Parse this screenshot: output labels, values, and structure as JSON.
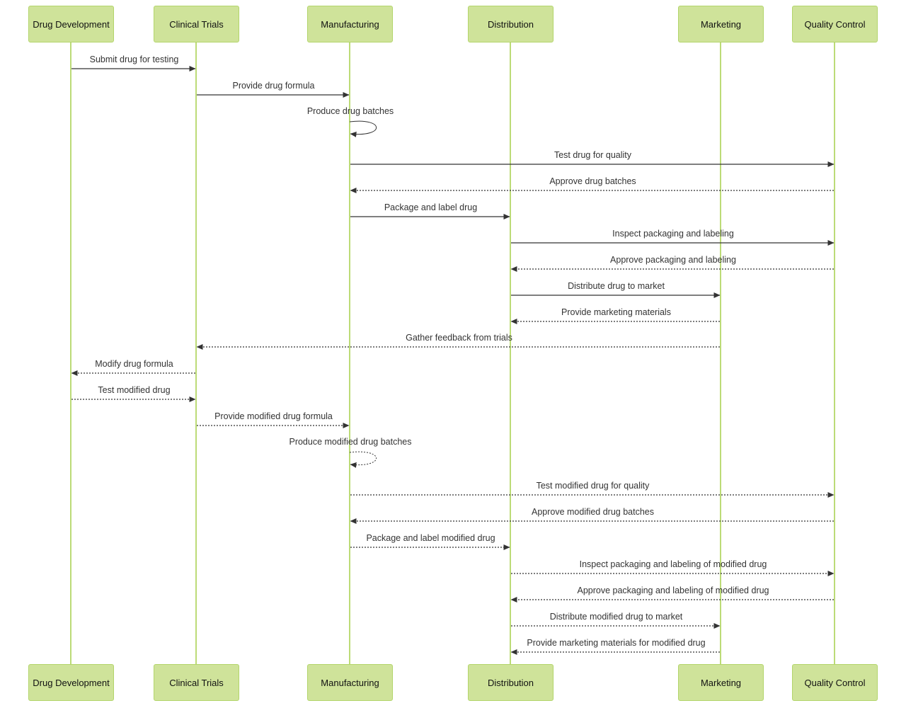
{
  "participants": [
    "Drug Development",
    "Clinical Trials",
    "Manufacturing",
    "Distribution",
    "Marketing",
    "Quality Control"
  ],
  "colors": {
    "actor_fill": "#cfe39a",
    "actor_border": "#b3d56b",
    "lifeline": "#a6cf4a",
    "arrow": "#333333"
  },
  "messages": [
    {
      "from": 0,
      "to": 1,
      "label": "Submit drug for testing",
      "style": "solid"
    },
    {
      "from": 1,
      "to": 2,
      "label": "Provide drug formula",
      "style": "solid"
    },
    {
      "from": 2,
      "to": 2,
      "label": "Produce drug batches",
      "style": "solid"
    },
    {
      "from": 2,
      "to": 5,
      "label": "Test drug for quality",
      "style": "solid"
    },
    {
      "from": 5,
      "to": 2,
      "label": "Approve drug batches",
      "style": "dotted"
    },
    {
      "from": 2,
      "to": 3,
      "label": "Package and label drug",
      "style": "solid"
    },
    {
      "from": 3,
      "to": 5,
      "label": "Inspect packaging and labeling",
      "style": "solid"
    },
    {
      "from": 5,
      "to": 3,
      "label": "Approve packaging and labeling",
      "style": "dotted"
    },
    {
      "from": 3,
      "to": 4,
      "label": "Distribute drug to market",
      "style": "solid"
    },
    {
      "from": 4,
      "to": 3,
      "label": "Provide marketing materials",
      "style": "dotted"
    },
    {
      "from": 4,
      "to": 1,
      "label": "Gather feedback from trials",
      "style": "dotted"
    },
    {
      "from": 1,
      "to": 0,
      "label": "Modify drug formula",
      "style": "dotted"
    },
    {
      "from": 0,
      "to": 1,
      "label": "Test modified drug",
      "style": "dotted"
    },
    {
      "from": 1,
      "to": 2,
      "label": "Provide modified drug formula",
      "style": "dotted"
    },
    {
      "from": 2,
      "to": 2,
      "label": "Produce modified drug batches",
      "style": "dotted"
    },
    {
      "from": 2,
      "to": 5,
      "label": "Test modified drug for quality",
      "style": "dotted"
    },
    {
      "from": 5,
      "to": 2,
      "label": "Approve modified drug batches",
      "style": "dotted"
    },
    {
      "from": 2,
      "to": 3,
      "label": "Package and label modified drug",
      "style": "dotted"
    },
    {
      "from": 3,
      "to": 5,
      "label": "Inspect packaging and labeling of modified drug",
      "style": "dotted"
    },
    {
      "from": 5,
      "to": 3,
      "label": "Approve packaging and labeling of modified drug",
      "style": "dotted"
    },
    {
      "from": 3,
      "to": 4,
      "label": "Distribute modified drug to market",
      "style": "dotted"
    },
    {
      "from": 4,
      "to": 3,
      "label": "Provide marketing materials for modified drug",
      "style": "dotted"
    }
  ]
}
